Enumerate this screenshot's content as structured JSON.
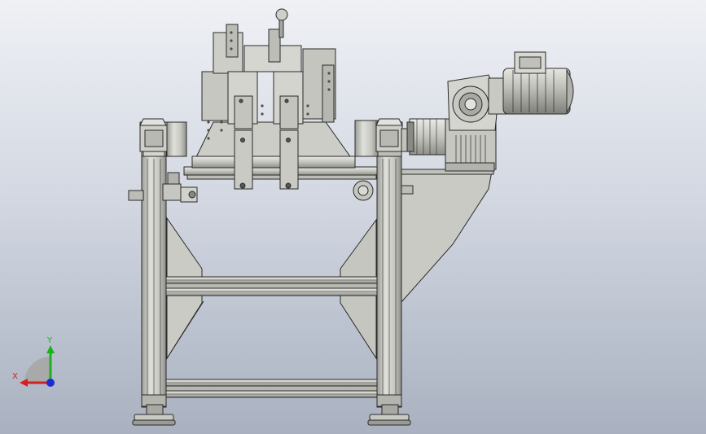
{
  "viewport": {
    "background_top": "#eff1f5",
    "background_bottom": "#a9b1c0"
  },
  "model": {
    "fill_light": "#d9d9d4",
    "fill_mid": "#c2c2bc",
    "fill_dark": "#8e8e88",
    "outline": "#2a2a2a"
  },
  "triad": {
    "x_label": "X",
    "y_label": "Y",
    "x_color": "#d42020",
    "y_color": "#19b219",
    "z_color": "#1d2bd6"
  }
}
